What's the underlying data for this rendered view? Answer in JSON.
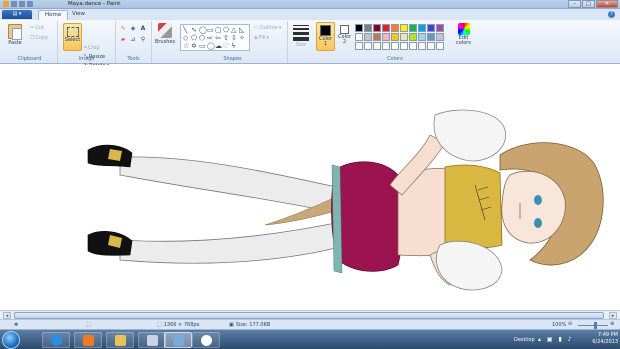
{
  "window": {
    "title": "Maya.dance - Paint",
    "controls": [
      "–",
      "□",
      "✕"
    ]
  },
  "quick_access": [
    "paint-app-icon",
    "save-icon",
    "undo-icon",
    "redo-icon",
    "dropdown-icon"
  ],
  "tabs": {
    "menu_icon": "paint-menu-icon",
    "items": [
      {
        "label": "Home",
        "active": true
      },
      {
        "label": "View",
        "active": false
      }
    ],
    "help": "?"
  },
  "ribbon": {
    "clipboard": {
      "label": "Clipboard",
      "paste": "Paste",
      "cut": "Cut",
      "copy": "Copy"
    },
    "image": {
      "label": "Image",
      "select": "Select",
      "crop": "Crop",
      "resize": "Resize",
      "rotate": "Rotate"
    },
    "tools": {
      "label": "Tools",
      "icons": [
        "pencil-icon",
        "fill-icon",
        "text-icon",
        "eraser-icon",
        "color-picker-icon",
        "magnifier-icon"
      ]
    },
    "brushes": {
      "label": "Brushes"
    },
    "shapes": {
      "label": "Shapes",
      "outline": "Outline",
      "fill": "Fill"
    },
    "size": {
      "label": "Size"
    },
    "colors": {
      "label": "Colors",
      "color1": "Color 1",
      "color2": "Color 2",
      "color1_value": "#000000",
      "color2_value": "#ffffff",
      "edit_colors": "Edit colors",
      "palette": [
        "#000000",
        "#7f7f7f",
        "#880015",
        "#ed1c24",
        "#ff7f27",
        "#fff200",
        "#22b14c",
        "#00a2e8",
        "#3f48cc",
        "#a349a4",
        "#ffffff",
        "#c3c3c3",
        "#b97a57",
        "#ffaec9",
        "#ffc90e",
        "#efe4b0",
        "#b5e61d",
        "#99d9ea",
        "#7092be",
        "#c8bfe7",
        "#ffffff",
        "#ffffff",
        "#ffffff",
        "#ffffff",
        "#ffffff",
        "#ffffff",
        "#ffffff",
        "#ffffff",
        "#ffffff",
        "#ffffff"
      ]
    }
  },
  "status": {
    "dimensions": "1366 × 768px",
    "size": "Size: 177.0KB",
    "zoom": "100%",
    "zoom_level": 1.0
  },
  "taskbar": {
    "apps": [
      "ie-icon",
      "media-player-icon",
      "explorer-icon",
      "paint-icon",
      "chat-icon"
    ],
    "desktop_label": "Desktop",
    "time": "7:49 PM",
    "date": "6/24/2013"
  }
}
